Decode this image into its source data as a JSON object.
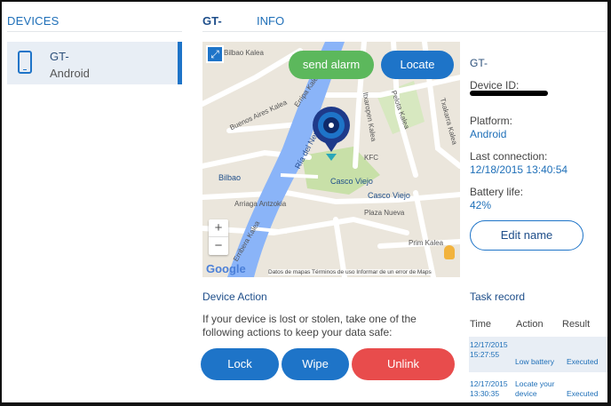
{
  "header": {
    "devices_tab": "DEVICES",
    "device_tab": "GT-",
    "info_tab": "INFO"
  },
  "sidebar": {
    "items": [
      {
        "name": "GT-",
        "os": "Android",
        "icon": "phone-icon",
        "selected": true
      }
    ]
  },
  "map": {
    "alarm_button": "send alarm",
    "locate_button": "Locate",
    "zoom_in": "+",
    "zoom_out": "−",
    "labels": {
      "bilbao_kalea": "Bilbao Kalea",
      "buenos_aires": "Buenos Aires Kalea",
      "ripa_kalea": "Erripa Kalea",
      "ria": "Ría del Nervión",
      "itxaropen": "Itxaropen Kalea",
      "pelota": "Pelota Kalea",
      "txakarra": "Txakarra Kalea",
      "kfc": "KFC",
      "bilbao_metro": "Bilbao",
      "casco_viejo_1": "Casco Viejo",
      "casco_viejo_2": "Casco Viejo",
      "arriaga": "Arriaga Antzokia",
      "plaza_nueva": "Plaza Nueva",
      "prim_kalea": "Prim Kalea",
      "erribera": "Erribera Kalea"
    },
    "google": "Google",
    "footer": "Datos de mapas    Términos de uso    Informar de un error de Maps"
  },
  "info": {
    "name": "GT-",
    "device_id_label": "Device ID:",
    "platform_label": "Platform:",
    "platform_value": "Android",
    "last_connection_label": "Last connection:",
    "last_connection_value": "12/18/2015 13:40:54",
    "battery_label": "Battery life:",
    "battery_value": "42%",
    "edit_button": "Edit name"
  },
  "device_action": {
    "title": "Device Action",
    "description": "If your device is lost or stolen, take one of the following actions to keep your data safe:",
    "lock_button": "Lock",
    "wipe_button": "Wipe",
    "unlink_button": "Unlink"
  },
  "task_record": {
    "title": "Task record",
    "columns": [
      "Time",
      "Action",
      "Result"
    ],
    "rows": [
      {
        "date": "12/17/2015",
        "time": "15:27:55",
        "action": "Low battery",
        "result": "Executed"
      },
      {
        "date": "12/17/2015",
        "time": "13:30:35",
        "action": "Locate your device",
        "result": "Executed"
      }
    ]
  },
  "colors": {
    "primary": "#1e74c8",
    "alarm": "#5cb85c",
    "danger": "#e84c4c",
    "selected_bg": "#e8eef5"
  }
}
